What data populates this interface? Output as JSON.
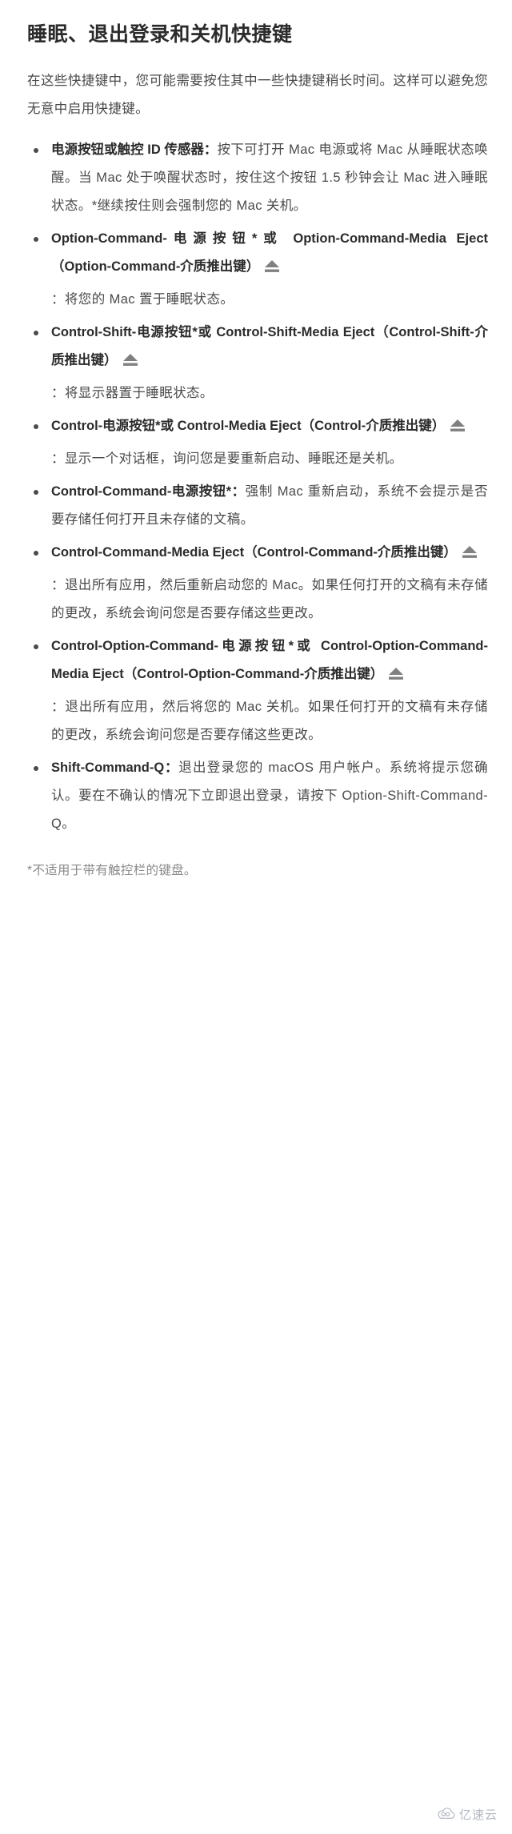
{
  "page": {
    "title": "睡眠、退出登录和关机快捷键",
    "intro": "在这些快捷键中，您可能需要按住其中一些快捷键稍长时间。这样可以避免您无意中启用快捷键。",
    "footnote": "*不适用于带有触控栏的键盘。"
  },
  "items": [
    {
      "id": "power-button-touch-id",
      "bold": "电源按钮或触控 ID 传感器：",
      "text": "按下可打开 Mac 电源或将 Mac 从睡眠状态唤醒。当 Mac 处于唤醒状态时，按住这个按钮 1.5 秒钟会让 Mac 进入睡眠状态。*继续按住则会强制您的 Mac 关机。",
      "eject": false
    },
    {
      "id": "option-command-power",
      "bold": "Option-Command-电源按钮*或 Option-Command-Media Eject（Option-Command-介质推出键）",
      "text": "",
      "eject": true
    },
    {
      "id": "option-command-power-desc",
      "bold": "",
      "text": "：将您的 Mac 置于睡眠状态。",
      "eject": false
    },
    {
      "id": "control-shift-power",
      "bold": "Control-Shift-电源按钮*或 Control-Shift-Media Eject（Control-Shift-介质推出键）",
      "text": "",
      "eject": true
    },
    {
      "id": "control-shift-power-desc",
      "bold": "",
      "text": "：将显示器置于睡眠状态。",
      "eject": false
    },
    {
      "id": "control-power",
      "bold": "Control-电源按钮*或 Control-Media Eject（Control-介质推出键）",
      "text": "",
      "eject": true
    },
    {
      "id": "control-power-desc",
      "bold": "",
      "text": "：显示一个对话框，询问您是要重新启动、睡眠还是关机。",
      "eject": false
    },
    {
      "id": "control-command-power",
      "bold": "Control-Command-电源按钮*：",
      "text": "强制 Mac 重新启动，系统不会提示是否要存储任何打开且未存储的文稿。",
      "eject": false
    },
    {
      "id": "control-command-media-eject",
      "bold": "Control-Command-Media Eject（Control-Command-介质推出键）",
      "text": "",
      "eject": true
    },
    {
      "id": "control-command-media-eject-desc",
      "bold": "",
      "text": "：退出所有应用，然后重新启动您的 Mac。如果任何打开的文稿有未存储的更改，系统会询问您是否要存储这些更改。",
      "eject": false
    },
    {
      "id": "control-option-command-power",
      "bold": "Control-Option-Command-电源按钮*或 Control-Option-Command-Media Eject（Control-Option-Command-介质推出键）",
      "text": "",
      "eject": true
    },
    {
      "id": "control-option-command-power-desc",
      "bold": "",
      "text": "：退出所有应用，然后将您的 Mac 关机。如果任何打开的文稿有未存储的更改，系统会询问您是否要存储这些更改。",
      "eject": false
    },
    {
      "id": "shift-command-q",
      "bold": "Shift-Command-Q：",
      "text": "退出登录您的 macOS 用户帐户。系统将提示您确认。要在不确认的情况下立即退出登录，请按下 Option-Shift-Command-Q。",
      "eject": false
    }
  ],
  "watermark": {
    "label": "亿速云",
    "icon": "cloud-icon"
  },
  "colors": {
    "title": "#2b2b2b",
    "body": "#4a4a4a",
    "bold": "#2b2b2b",
    "footnote": "#8a8a8a",
    "eject": "#808080",
    "watermark": "#b3b8c2",
    "background": "#ffffff"
  }
}
